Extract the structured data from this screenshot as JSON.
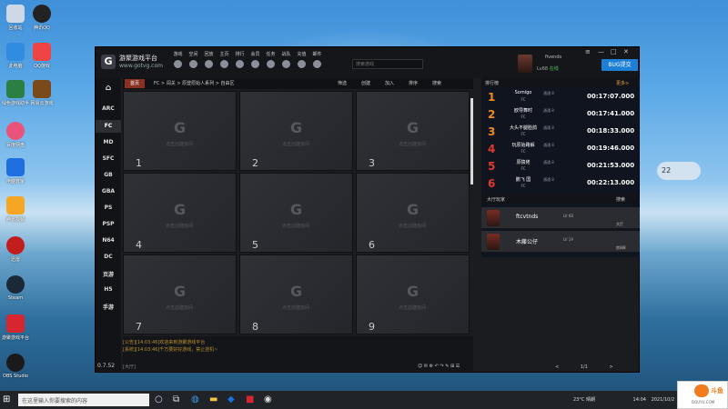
{
  "desktop": {
    "icons": [
      {
        "label": "回收站",
        "icon": "recycle-bin-icon"
      },
      {
        "label": "腾讯QQ",
        "icon": "qq-penguin-icon"
      },
      {
        "label": "此电脑",
        "icon": "computer-icon"
      },
      {
        "label": "QQ游戏",
        "icon": "qq-game-icon"
      },
      {
        "label": "绿色游戏助手",
        "icon": "game-pad-icon"
      },
      {
        "label": "网易云游戏",
        "icon": "game-char-icon"
      },
      {
        "label": "百度网盘",
        "icon": "cloud-icon"
      },
      {
        "label": "电脑管家",
        "icon": "shield-icon"
      },
      {
        "label": "腾讯视频",
        "icon": "video-icon"
      },
      {
        "label": "迅雷",
        "icon": "bird-icon"
      },
      {
        "label": "Steam",
        "icon": "steam-icon"
      },
      {
        "label": "游聚游戏平台",
        "icon": "gamer-platform-icon"
      },
      {
        "label": "OBS Studio",
        "icon": "obs-icon"
      }
    ]
  },
  "app": {
    "title": "游聚游戏平台",
    "url": "www.gotvg.com",
    "nav": [
      {
        "label": "游戏",
        "icon": "controller-icon"
      },
      {
        "label": "空间",
        "icon": "space-icon"
      },
      {
        "label": "回放",
        "icon": "replay-icon"
      },
      {
        "label": "主页",
        "icon": "home-icon"
      },
      {
        "label": "排行",
        "icon": "chart-icon"
      },
      {
        "label": "会员",
        "icon": "crown-icon"
      },
      {
        "label": "任务",
        "icon": "flag-icon"
      },
      {
        "label": "战队",
        "icon": "team-icon"
      },
      {
        "label": "充值",
        "icon": "coin-icon"
      },
      {
        "label": "邮件",
        "icon": "mail-icon"
      }
    ],
    "search_placeholder": "搜索游戏",
    "user": {
      "name": "fivends",
      "level": "Lv68",
      "status": "在线"
    },
    "bug_button": "BUG提交",
    "window_controls": {
      "menu": "≡",
      "min": "—",
      "max": "□",
      "close": "✕"
    },
    "sidebar": {
      "home_icon": "home-icon",
      "categories": [
        "ARC",
        "FC",
        "MD",
        "SFC",
        "GB",
        "GBA",
        "PS",
        "PSP",
        "N64",
        "DC",
        "页游",
        "H5",
        "手游"
      ],
      "active": "FC",
      "version": "0.7.52"
    },
    "breadcrumb": {
      "home": "首页",
      "path": "FC > 闯关 > 原登原始人系列 > 自由区",
      "actions": [
        "筛选",
        "创建",
        "加入",
        "排序",
        "搜索"
      ]
    },
    "rooms": {
      "placeholder": "点击创建房间",
      "numbers": [
        "1",
        "2",
        "3",
        "4",
        "5",
        "6",
        "7",
        "8",
        "9"
      ]
    },
    "chat": {
      "lines": [
        "[公告][14:03:46]欢迎来到游聚游戏平台",
        "[系统][14:03:46]千万要好好游戏，禁止挂机~"
      ],
      "input_label": "[大厅]"
    },
    "ranking": {
      "title": "排行榜",
      "more": "更多>",
      "rows": [
        {
          "rank": "1",
          "name": "Somigo",
          "sub": "FC",
          "mode": "通通 8",
          "time": "00:17:07.000"
        },
        {
          "rank": "2",
          "name": "欧导舞时",
          "sub": "FC",
          "mode": "通通 8",
          "time": "00:17:41.000"
        },
        {
          "rank": "3",
          "name": "大头不腿脸鸽",
          "sub": "FC",
          "mode": "通通 8",
          "time": "00:18:33.000"
        },
        {
          "rank": "4",
          "name": "玩原始路解",
          "sub": "FC",
          "mode": "通通 8",
          "time": "00:19:46.000"
        },
        {
          "rank": "5",
          "name": "原猿佬",
          "sub": "FC",
          "mode": "通通 8",
          "time": "00:21:53.000"
        },
        {
          "rank": "6",
          "name": "鹏飞 国",
          "sub": "FC",
          "mode": "通通 8",
          "time": "00:22:13.000"
        }
      ]
    },
    "hall": {
      "title": "大厅玩家",
      "search": "搜索",
      "players": [
        {
          "name": "ftcvtnds",
          "level": "LV 68",
          "status": "大厅"
        },
        {
          "name": "木藤公仔",
          "level": "LV 19",
          "status": "房间8"
        }
      ]
    },
    "pager": {
      "prev": "<",
      "current": "1/1",
      "next": ">"
    }
  },
  "weather_widget": {
    "temp": "22"
  },
  "taskbar": {
    "search_placeholder": "在这里输入你要搜索的内容",
    "tray_weather": "23°C 晴朗",
    "tray_time": "14:04",
    "tray_date": "2021/10/2"
  },
  "watermark": {
    "text": "斗鱼",
    "sub": "DOUYU.COM"
  }
}
